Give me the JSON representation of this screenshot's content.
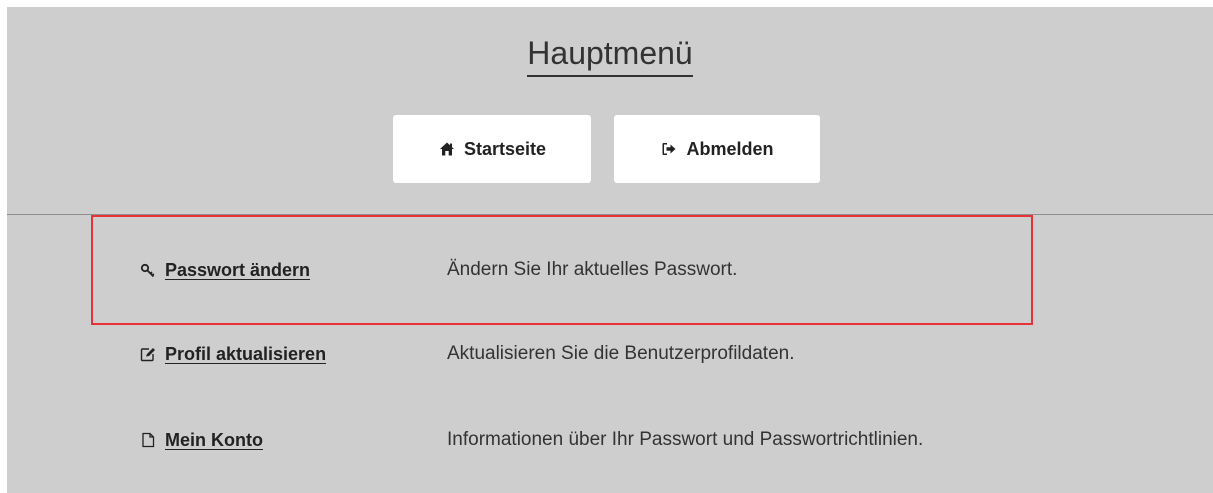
{
  "header": {
    "title": "Hauptmenü"
  },
  "toolbar": {
    "home_label": "Startseite",
    "logout_label": "Abmelden"
  },
  "menu": {
    "items": [
      {
        "label": "Passwort ändern",
        "description": "Ändern Sie Ihr aktuelles Passwort.",
        "icon": "key-icon"
      },
      {
        "label": "Profil aktualisieren",
        "description": "Aktualisieren Sie die Benutzerprofildaten.",
        "icon": "edit-icon"
      },
      {
        "label": "Mein Konto",
        "description": "Informationen über Ihr Passwort und Passwortrichtlinien.",
        "icon": "document-icon"
      }
    ]
  },
  "colors": {
    "background": "#cecece",
    "button_bg": "#ffffff",
    "highlight_border": "#e8323a",
    "text": "#333333"
  }
}
